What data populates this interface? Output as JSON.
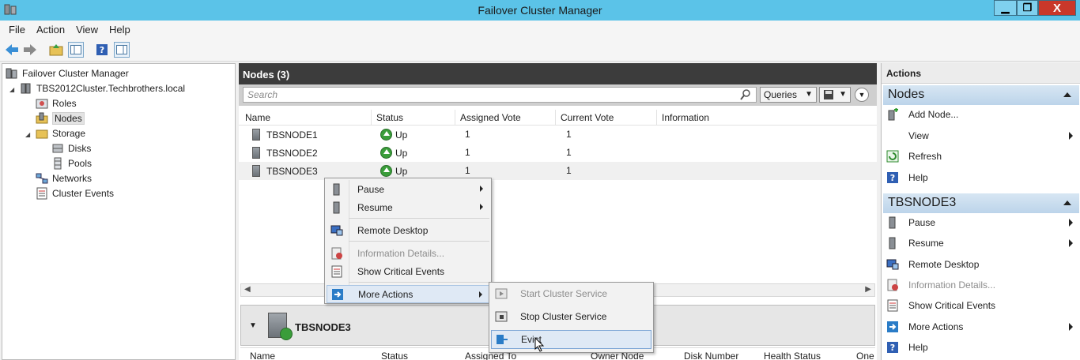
{
  "window": {
    "title": "Failover Cluster Manager",
    "min": "▁",
    "max": "❐",
    "close": "X"
  },
  "menu": [
    "File",
    "Action",
    "View",
    "Help"
  ],
  "tree": {
    "root": "Failover Cluster Manager",
    "cluster": "TBS2012Cluster.Techbrothers.local",
    "roles": "Roles",
    "nodes": "Nodes",
    "storage": "Storage",
    "disks": "Disks",
    "pools": "Pools",
    "networks": "Networks",
    "events": "Cluster Events"
  },
  "center": {
    "title": "Nodes (3)",
    "search_placeholder": "Search",
    "queries_label": "Queries",
    "columns": [
      "Name",
      "Status",
      "Assigned Vote",
      "Current Vote",
      "Information"
    ],
    "rows": [
      {
        "name": "TBSNODE1",
        "status": "Up",
        "assigned": "1",
        "current": "1"
      },
      {
        "name": "TBSNODE2",
        "status": "Up",
        "assigned": "1",
        "current": "1"
      },
      {
        "name": "TBSNODE3",
        "status": "Up",
        "assigned": "1",
        "current": "1"
      }
    ],
    "detail_title": "TBSNODE3",
    "detail_columns": [
      "Name",
      "Status",
      "Assigned To",
      "Owner Node",
      "Disk Number",
      "Health Status",
      "One"
    ]
  },
  "context_menu": {
    "pause": "Pause",
    "resume": "Resume",
    "remote_desktop": "Remote Desktop",
    "info_details": "Information Details...",
    "critical_events": "Show Critical Events",
    "more_actions": "More Actions"
  },
  "submenu": {
    "start": "Start Cluster Service",
    "stop": "Stop Cluster Service",
    "evict": "Evict"
  },
  "actions": {
    "title": "Actions",
    "nodes_section": "Nodes",
    "add_node": "Add Node...",
    "view": "View",
    "refresh": "Refresh",
    "help": "Help",
    "node_section": "TBSNODE3",
    "pause": "Pause",
    "resume": "Resume",
    "remote_desktop": "Remote Desktop",
    "info_details": "Information Details...",
    "critical_events": "Show Critical Events",
    "more_actions": "More Actions",
    "help2": "Help"
  }
}
